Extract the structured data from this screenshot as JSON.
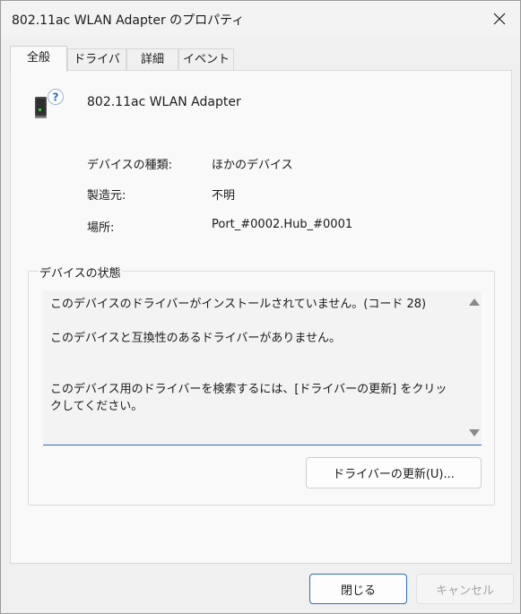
{
  "window": {
    "title": "802.11ac WLAN Adapter のプロパティ"
  },
  "tabs": [
    {
      "label": "全般",
      "active": true
    },
    {
      "label": "ドライバー",
      "active": false
    },
    {
      "label": "詳細",
      "active": false
    },
    {
      "label": "イベント",
      "active": false
    }
  ],
  "general": {
    "device_name": "802.11ac WLAN Adapter",
    "properties": [
      {
        "label": "デバイスの種類:",
        "value": "ほかのデバイス"
      },
      {
        "label": "製造元:",
        "value": "不明"
      },
      {
        "label": "場所:",
        "value": "Port_#0002.Hub_#0001"
      }
    ],
    "status_group_label": "デバイスの状態",
    "status_text": "このデバイスのドライバーがインストールされていません。(コード 28)\n\nこのデバイスと互換性のあるドライバーがありません。\n\n\nこのデバイス用のドライバーを検索するには、[ドライバーの更新] をクリックしてください。",
    "update_button": "ドライバーの更新(U)..."
  },
  "footer": {
    "ok_label": "閉じる",
    "cancel_label": "キャンセル"
  },
  "colors": {
    "accent": "#2c6dba",
    "disabled_text": "#a3a3a3"
  }
}
